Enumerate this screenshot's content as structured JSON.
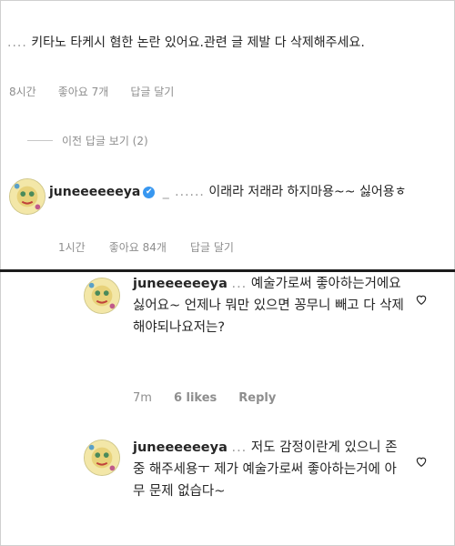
{
  "top": {
    "comment_prefix": "....",
    "comment_text": "키타노 타케시 혐한 논란 있어요.관련 글 제발 다 삭제해주세요.",
    "meta": {
      "time": "8시간",
      "likes": "좋아요 7개",
      "reply": "답글 달기"
    },
    "view_previous": "이전 답글 보기 (2)"
  },
  "reply1": {
    "username": "juneeeeeeya",
    "verified_glyph": "✔",
    "masked": "_  ......",
    "text": "이래라 저래라 하지마용~~ 싫어용ㅎ",
    "meta": {
      "time": "1시간",
      "likes": "좋아요 84개",
      "reply": "답글 달기"
    }
  },
  "comment2": {
    "username": "juneeeeeeya",
    "masked": "...",
    "text": "예술가로써 좋아하는거에요 싫어요~ 언제나 뭐만 있으면 꽁무니 빼고 다 삭제해야되나요저는?",
    "meta": {
      "time": "7m",
      "likes": "6 likes",
      "reply": "Reply"
    }
  },
  "comment3": {
    "username": "juneeeeeeya",
    "masked": "...",
    "text": "저도 감정이란게 있으니 존중 해주세용ㅜ 제가 예술가로써 좋아하는거에 아무 문제 없습다~"
  },
  "colors": {
    "text": "#262626",
    "meta": "#8e8e8e",
    "verified": "#3897f0"
  },
  "icons": [
    "heart-icon",
    "verified-badge-icon",
    "avatar"
  ]
}
